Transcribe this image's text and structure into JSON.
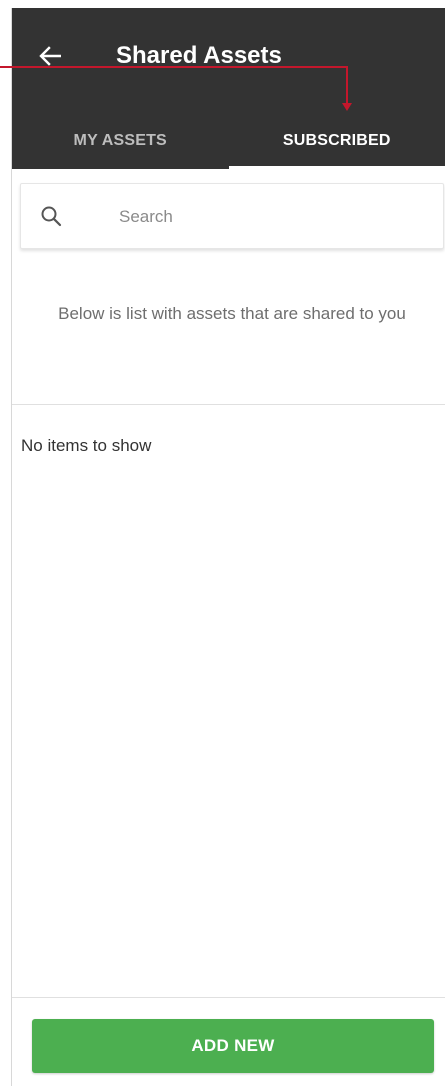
{
  "header": {
    "title": "Shared Assets",
    "back_icon": "arrow-left-icon"
  },
  "tabs": [
    {
      "label": "MY ASSETS",
      "active": false
    },
    {
      "label": "SUBSCRIBED",
      "active": true
    }
  ],
  "search": {
    "placeholder": "Search",
    "value": "",
    "icon": "search-icon"
  },
  "description": "Below is list with assets that are shared to you",
  "empty_message": "No items to show",
  "footer": {
    "add_button_label": "ADD NEW"
  },
  "colors": {
    "appbar": "#333333",
    "accent_annotation": "#c4172c",
    "add_button": "#4caf50",
    "tab_active": "#ffffff",
    "tab_inactive": "#bdbdbd"
  }
}
